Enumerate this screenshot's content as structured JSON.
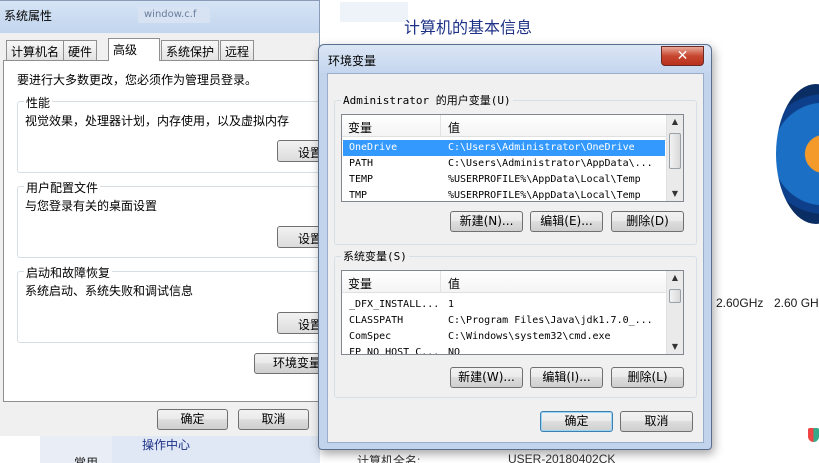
{
  "background": {
    "title": "计算机的基本信息",
    "search_placeholder": "window.c.f",
    "cpu_speed": "2.60GHz",
    "cpu_speed_2": "2.60 GH",
    "computer_name_label": "计算机全名:",
    "computer_name_value": "USER-20180402CK",
    "nav_item": "操作中心",
    "nav_item_2": "常用"
  },
  "system_properties": {
    "title": "系统属性",
    "tabs": [
      "计算机名",
      "硬件",
      "高级",
      "系统保护",
      "远程"
    ],
    "active_tab": "高级",
    "admin_note": "要进行大多数更改，您必须作为管理员登录。",
    "groups": [
      {
        "title": "性能",
        "desc": "视觉效果，处理器计划，内存使用，以及虚拟内存",
        "button": "设置"
      },
      {
        "title": "用户配置文件",
        "desc": "与您登录有关的桌面设置",
        "button": "设置"
      },
      {
        "title": "启动和故障恢复",
        "desc": "系统启动、系统失败和调试信息",
        "button": "设置"
      }
    ],
    "env_button": "环境变量",
    "ok": "确定",
    "cancel": "取消"
  },
  "env_dialog": {
    "title": "环境变量",
    "close_glyph": "✕",
    "user_group_title": "Administrator 的用户变量(U)",
    "col_variable": "变量",
    "col_value": "值",
    "user_vars": [
      {
        "name": "OneDrive",
        "value": "C:\\Users\\Administrator\\OneDrive"
      },
      {
        "name": "PATH",
        "value": "C:\\Users\\Administrator\\AppData\\..."
      },
      {
        "name": "TEMP",
        "value": "%USERPROFILE%\\AppData\\Local\\Temp"
      },
      {
        "name": "TMP",
        "value": "%USERPROFILE%\\AppData\\Local\\Temp"
      }
    ],
    "user_buttons": {
      "new": "新建(N)...",
      "edit": "编辑(E)...",
      "delete": "删除(D)"
    },
    "sys_group_title": "系统变量(S)",
    "sys_vars": [
      {
        "name": "_DFX_INSTALL...",
        "value": "1"
      },
      {
        "name": "CLASSPATH",
        "value": "C:\\Program Files\\Java\\jdk1.7.0_..."
      },
      {
        "name": "ComSpec",
        "value": "C:\\Windows\\system32\\cmd.exe"
      },
      {
        "name": "FP_NO_HOST_C...",
        "value": "NO"
      }
    ],
    "sys_buttons": {
      "new": "新建(W)...",
      "edit": "编辑(I)...",
      "delete": "删除(L)"
    },
    "ok": "确定",
    "cancel": "取消"
  }
}
